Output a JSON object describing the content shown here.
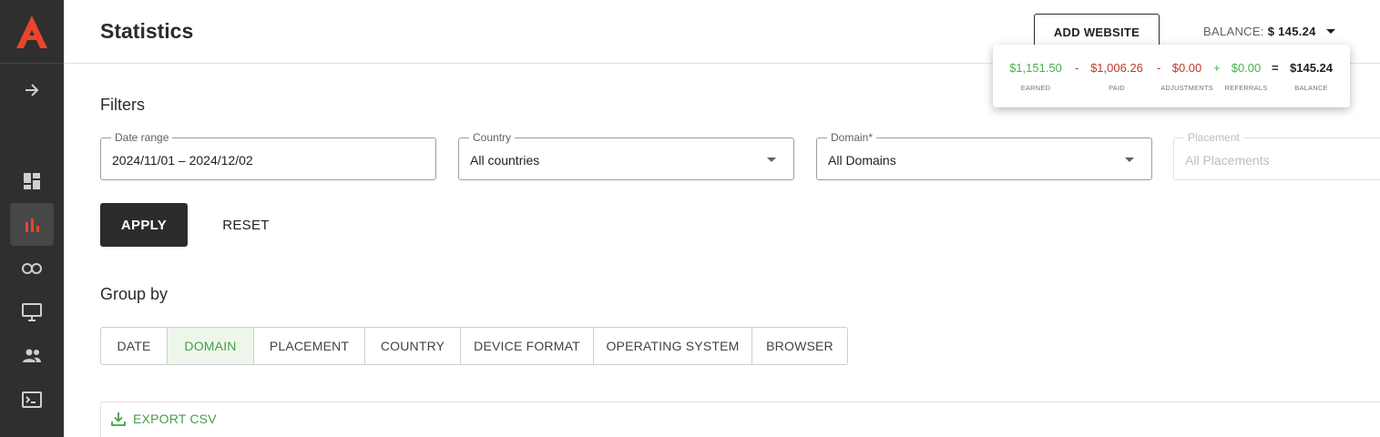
{
  "sidebar": {
    "logo": "logo-icon",
    "expand_icon": "arrow-right-icon",
    "items": [
      {
        "icon": "dashboard-icon",
        "active": false
      },
      {
        "icon": "bar-chart-icon",
        "active": true
      },
      {
        "icon": "link-icon",
        "active": false
      },
      {
        "icon": "monitor-icon",
        "active": false
      },
      {
        "icon": "users-icon",
        "active": false
      },
      {
        "icon": "terminal-icon",
        "active": false
      }
    ]
  },
  "header": {
    "title": "Statistics",
    "add_website_label": "ADD WEBSITE",
    "balance_label": "BALANCE:",
    "balance_value": "$ 145.24"
  },
  "balance_breakdown": {
    "earned": {
      "value": "$1,151.50",
      "label": "EARNED"
    },
    "op1": "-",
    "paid": {
      "value": "$1,006.26",
      "label": "PAID"
    },
    "op2": "-",
    "adjustments": {
      "value": "$0.00",
      "label": "ADJUSTMENTS"
    },
    "op3": "+",
    "referrals": {
      "value": "$0.00",
      "label": "REFERRALS"
    },
    "op4": "=",
    "balance": {
      "value": "$145.24",
      "label": "BALANCE"
    },
    "colors": {
      "positive": "#4caf50",
      "negative": "#c0392b"
    }
  },
  "filters": {
    "title": "Filters",
    "date_range": {
      "label": "Date range",
      "value": "2024/11/01 – 2024/12/02"
    },
    "country": {
      "label": "Country",
      "value": "All countries"
    },
    "domain": {
      "label": "Domain*",
      "value": "All Domains"
    },
    "placement": {
      "label": "Placement",
      "value": "All Placements",
      "disabled": true
    },
    "apply_label": "APPLY",
    "reset_label": "RESET"
  },
  "group_by": {
    "title": "Group by",
    "options": [
      {
        "label": "DATE",
        "active": false
      },
      {
        "label": "DOMAIN",
        "active": true
      },
      {
        "label": "PLACEMENT",
        "active": false
      },
      {
        "label": "COUNTRY",
        "active": false
      },
      {
        "label": "DEVICE FORMAT",
        "active": false
      },
      {
        "label": "OPERATING SYSTEM",
        "active": false
      },
      {
        "label": "BROWSER",
        "active": false
      }
    ]
  },
  "export": {
    "label": "EXPORT CSV",
    "icon": "download-icon"
  },
  "accent_color": "#43a047",
  "brand_color": "#e8452c"
}
